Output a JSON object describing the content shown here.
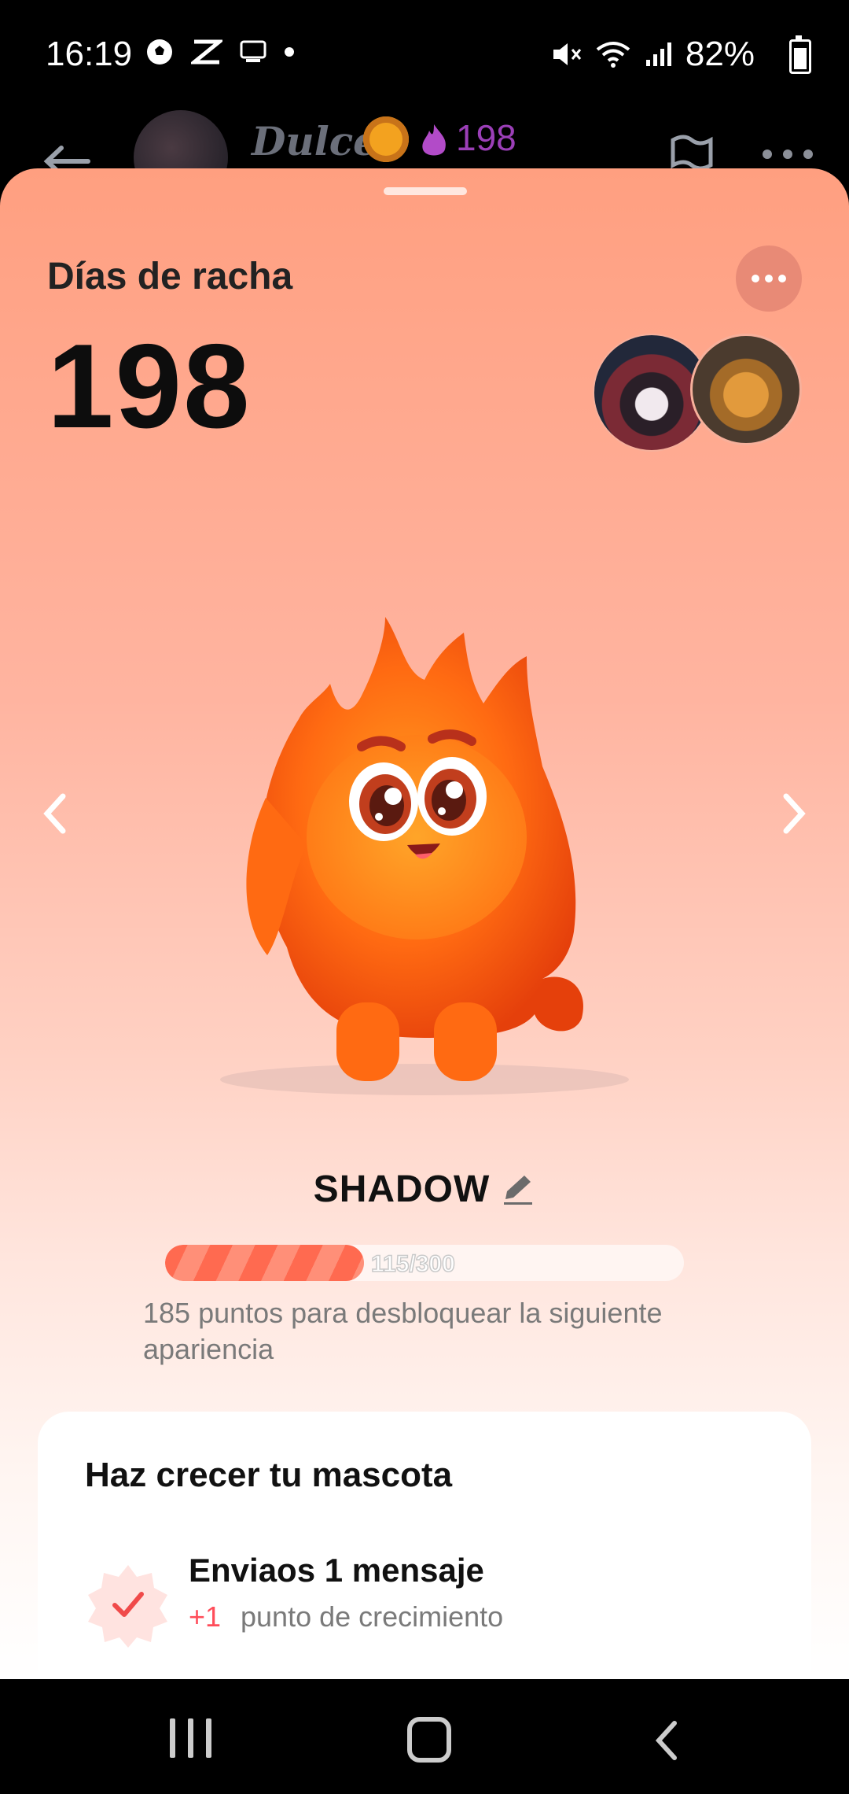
{
  "status_bar": {
    "time": "16:19",
    "battery": "82%",
    "icons": [
      "soccer-ball-icon",
      "capcut-icon",
      "ftp-icon",
      "dot-icon",
      "mute-icon",
      "wifi-icon",
      "signal-icon",
      "battery-charging-icon"
    ]
  },
  "chat_header": {
    "name": "Dulce",
    "emoji": "lion-icon",
    "streak_count": "198",
    "streak_color": "#9b3fb7"
  },
  "sheet": {
    "title": "Días de racha",
    "streak_days": "198",
    "background_colors": [
      "#ff9f80",
      "#ffb4a0",
      "#ffd0c2",
      "#ffffff"
    ]
  },
  "pet": {
    "name": "SHADOW",
    "progress_value": 115,
    "progress_max": 300,
    "progress_text": "115/300",
    "unlock_message": "185 puntos para desbloquear la siguiente apariencia"
  },
  "growth_card": {
    "title": "Haz crecer tu mascota",
    "tasks": [
      {
        "title": "Enviaos 1 mensaje",
        "points": "+1",
        "description": "punto de crecimiento",
        "completed": true
      }
    ]
  }
}
